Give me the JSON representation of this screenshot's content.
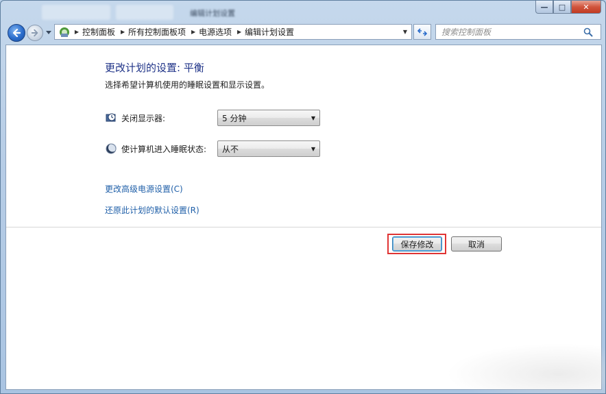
{
  "window": {
    "title": "编辑计划设置",
    "minimize_label": "—",
    "maximize_label": "□",
    "close_label": "✕"
  },
  "address": {
    "crumbs": [
      "控制面板",
      "所有控制面板项",
      "电源选项",
      "编辑计划设置"
    ]
  },
  "search": {
    "placeholder": "搜索控制面板"
  },
  "main": {
    "title": "更改计划的设置: 平衡",
    "description": "选择希望计算机使用的睡眠设置和显示设置。",
    "settings": [
      {
        "label": "关闭显示器:",
        "value": "5 分钟",
        "icon": "monitor-clock-icon"
      },
      {
        "label": "使计算机进入睡眠状态:",
        "value": "从不",
        "icon": "moon-icon"
      }
    ],
    "links": [
      "更改高级电源设置(C)",
      "还原此计划的默认设置(R)"
    ],
    "buttons": {
      "save_label": "保存修改",
      "cancel_label": "取消"
    }
  },
  "colors": {
    "title_blue": "#1e3287",
    "link_blue": "#1f5fa8",
    "highlight_red": "#e03434"
  }
}
